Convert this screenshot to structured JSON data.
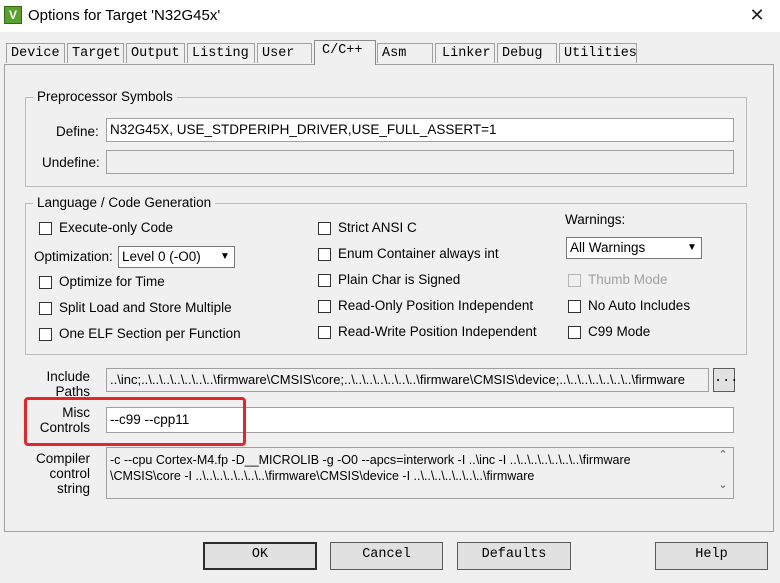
{
  "window": {
    "title": "Options for Target 'N32G45x'",
    "app_icon": "V",
    "close": "✕"
  },
  "tabs": [
    {
      "label": "Device"
    },
    {
      "label": "Target"
    },
    {
      "label": "Output"
    },
    {
      "label": "Listing"
    },
    {
      "label": "User"
    },
    {
      "label": "C/C++"
    },
    {
      "label": "Asm"
    },
    {
      "label": "Linker"
    },
    {
      "label": "Debug"
    },
    {
      "label": "Utilities"
    }
  ],
  "active_tab": "C/C++",
  "preprocessor": {
    "legend": "Preprocessor Symbols",
    "define_label": "Define:",
    "define_value": "N32G45X, USE_STDPERIPH_DRIVER,USE_FULL_ASSERT=1",
    "undefine_label": "Undefine:",
    "undefine_value": ""
  },
  "language": {
    "legend": "Language / Code Generation",
    "execute_only": "Execute-only Code",
    "optimization_label": "Optimization:",
    "optimization_value": "Level 0 (-O0)",
    "optimize_time": "Optimize for Time",
    "split_load": "Split Load and Store Multiple",
    "one_elf": "One ELF Section per Function",
    "strict_ansi": "Strict ANSI C",
    "enum_container": "Enum Container always int",
    "plain_char": "Plain Char is Signed",
    "ropi": "Read-Only Position Independent",
    "rwpi": "Read-Write Position Independent",
    "warnings_label": "Warnings:",
    "warnings_value": "All Warnings",
    "thumb_mode": "Thumb Mode",
    "no_auto_includes": "No Auto Includes",
    "c99_mode": "C99 Mode"
  },
  "include": {
    "label_line1": "Include",
    "label_line2": "Paths",
    "value": "..\\inc;..\\..\\..\\..\\..\\..\\..\\firmware\\CMSIS\\core;..\\..\\..\\..\\..\\..\\..\\firmware\\CMSIS\\device;..\\..\\..\\..\\..\\..\\..\\firmware",
    "browse": "..."
  },
  "misc": {
    "label_line1": "Misc",
    "label_line2": "Controls",
    "value": "--c99 --cpp11",
    "highlight_color": "#e8242b"
  },
  "compiler": {
    "label_line1": "Compiler",
    "label_line2": "control",
    "label_line3": "string",
    "line1": "-c --cpu Cortex-M4.fp -D__MICROLIB -g -O0 --apcs=interwork -I ..\\inc -I ..\\..\\..\\..\\..\\..\\..\\firmware",
    "line2": "\\CMSIS\\core -I ..\\..\\..\\..\\..\\..\\..\\firmware\\CMSIS\\device -I ..\\..\\..\\..\\..\\..\\..\\firmware"
  },
  "buttons": {
    "ok": "OK",
    "cancel": "Cancel",
    "defaults": "Defaults",
    "help": "Help"
  }
}
